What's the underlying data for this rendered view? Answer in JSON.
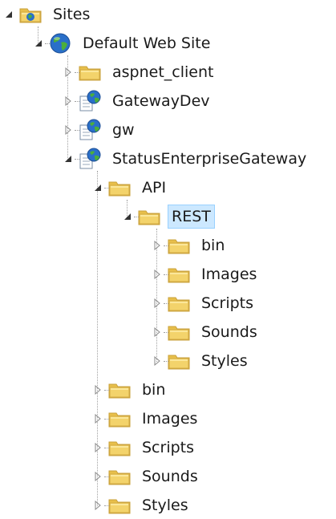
{
  "tree": {
    "nodes": [
      {
        "label": "Sites",
        "icon": "sites-folder-icon",
        "depth": 0,
        "state": "expanded"
      },
      {
        "label": "Default Web Site",
        "icon": "globe-icon",
        "depth": 1,
        "state": "expanded"
      },
      {
        "label": "aspnet_client",
        "icon": "folder-icon",
        "depth": 2,
        "state": "collapsed"
      },
      {
        "label": "GatewayDev",
        "icon": "web-application-icon",
        "depth": 2,
        "state": "collapsed"
      },
      {
        "label": "gw",
        "icon": "web-application-icon",
        "depth": 2,
        "state": "collapsed"
      },
      {
        "label": "StatusEnterpriseGateway",
        "icon": "web-application-icon",
        "depth": 2,
        "state": "expanded"
      },
      {
        "label": "API",
        "icon": "folder-icon",
        "depth": 3,
        "state": "expanded"
      },
      {
        "label": "REST",
        "icon": "folder-icon",
        "depth": 4,
        "state": "expanded",
        "selected": true
      },
      {
        "label": "bin",
        "icon": "folder-icon",
        "depth": 5,
        "state": "collapsed"
      },
      {
        "label": "Images",
        "icon": "folder-icon",
        "depth": 5,
        "state": "collapsed"
      },
      {
        "label": "Scripts",
        "icon": "folder-icon",
        "depth": 5,
        "state": "collapsed"
      },
      {
        "label": "Sounds",
        "icon": "folder-icon",
        "depth": 5,
        "state": "collapsed"
      },
      {
        "label": "Styles",
        "icon": "folder-icon",
        "depth": 5,
        "state": "collapsed"
      },
      {
        "label": "bin",
        "icon": "folder-icon",
        "depth": 3,
        "state": "collapsed"
      },
      {
        "label": "Images",
        "icon": "folder-icon",
        "depth": 3,
        "state": "collapsed"
      },
      {
        "label": "Scripts",
        "icon": "folder-icon",
        "depth": 3,
        "state": "collapsed"
      },
      {
        "label": "Sounds",
        "icon": "folder-icon",
        "depth": 3,
        "state": "collapsed"
      },
      {
        "label": "Styles",
        "icon": "folder-icon",
        "depth": 3,
        "state": "collapsed"
      }
    ]
  },
  "colors": {
    "selection_fill": "#cce8ff",
    "selection_border": "#99d1ff",
    "folder": "#f3d36b",
    "globe_blue": "#2a6fc9",
    "globe_green": "#4caf3a"
  }
}
